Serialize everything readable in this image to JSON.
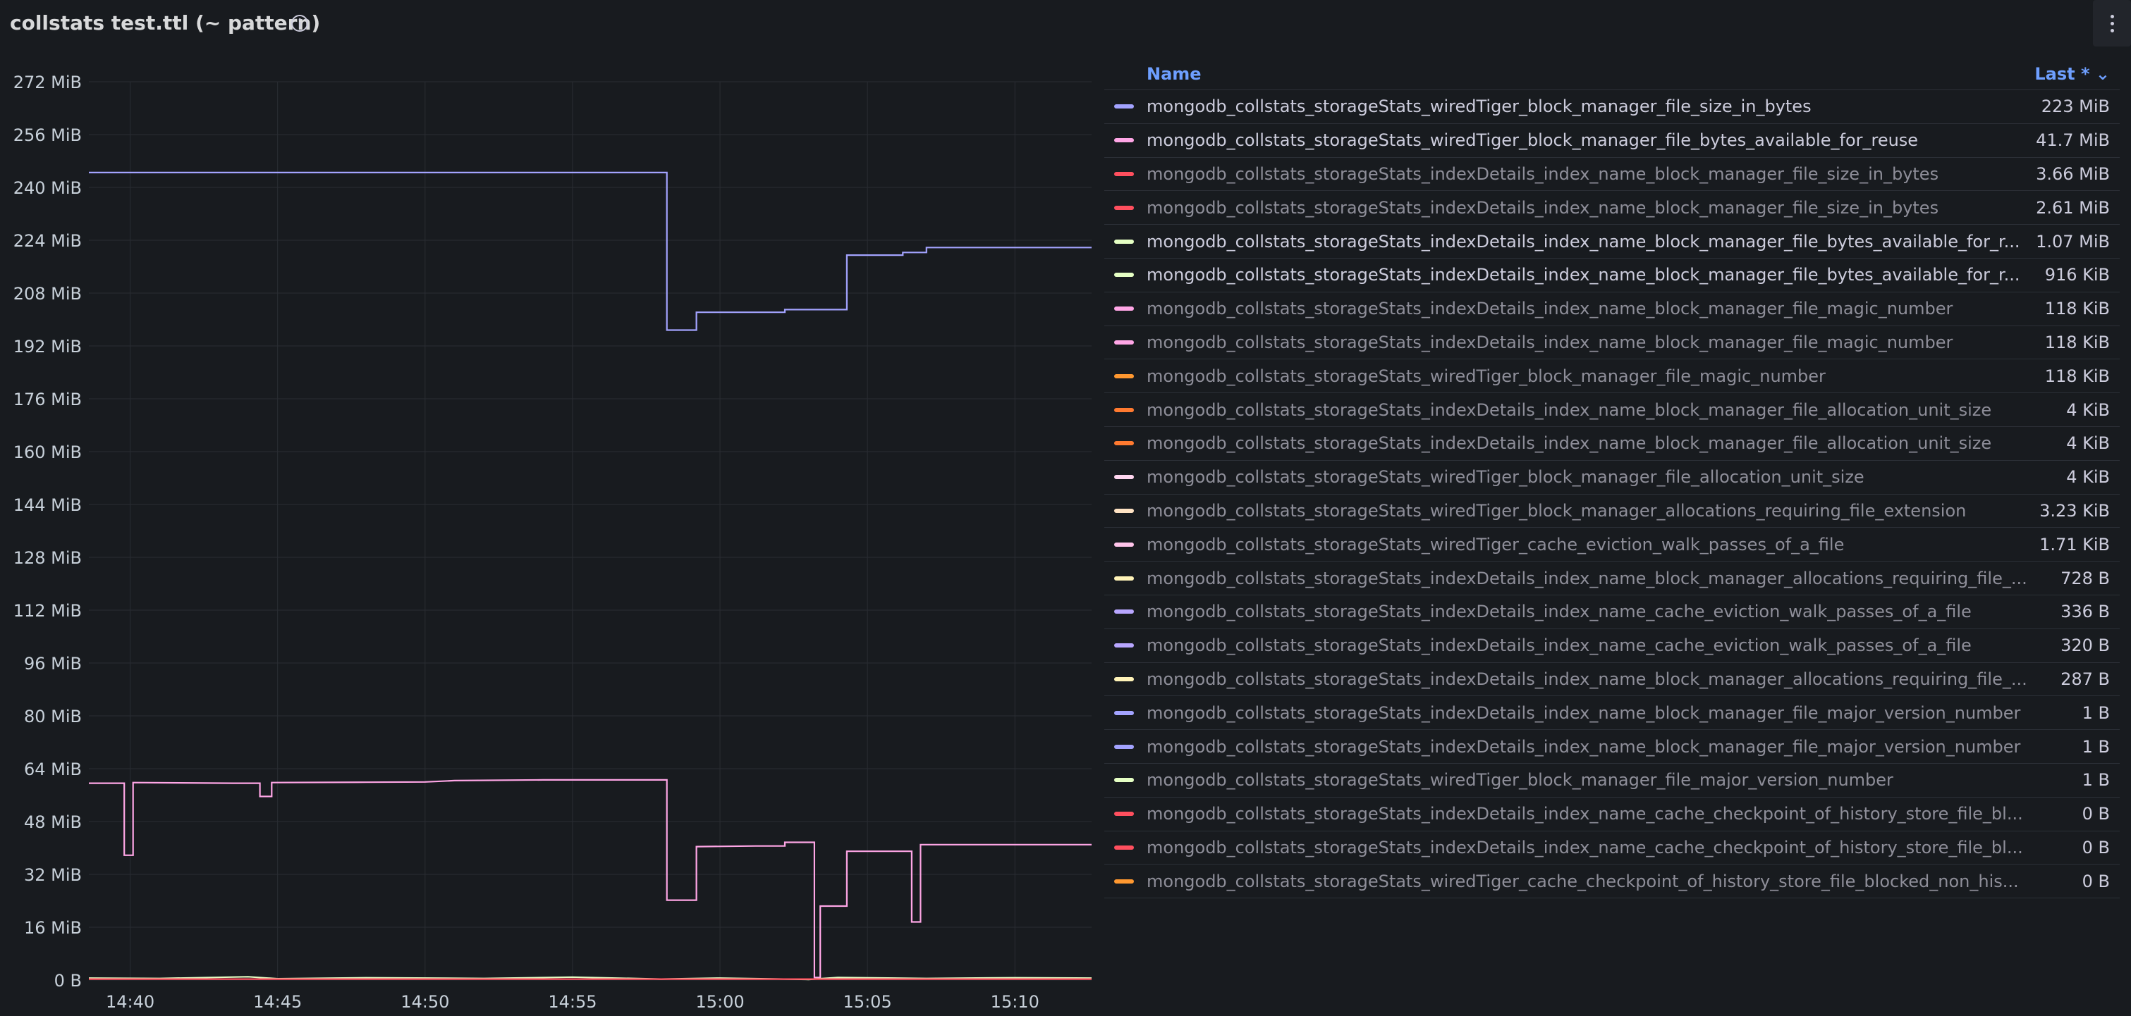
{
  "panel": {
    "title": "collstats test.ttl (~ pattern)",
    "info_icon": "info-circle-icon",
    "menu_icon": "vertical-ellipsis-icon"
  },
  "chart_data": {
    "type": "line",
    "y_ticks": [
      "272 MiB",
      "256 MiB",
      "240 MiB",
      "224 MiB",
      "208 MiB",
      "192 MiB",
      "176 MiB",
      "160 MiB",
      "144 MiB",
      "128 MiB",
      "112 MiB",
      "96 MiB",
      "80 MiB",
      "64 MiB",
      "48 MiB",
      "32 MiB",
      "16 MiB",
      "0 B"
    ],
    "y_tick_values": [
      272,
      256,
      240,
      224,
      208,
      192,
      176,
      160,
      144,
      128,
      112,
      96,
      80,
      64,
      48,
      32,
      16,
      0
    ],
    "ylim": [
      0,
      272
    ],
    "x_ticks": [
      "14:40",
      "14:45",
      "14:50",
      "14:55",
      "15:00",
      "15:05",
      "15:10"
    ],
    "x_tick_values": [
      40,
      45,
      50,
      55,
      60,
      65,
      70
    ],
    "xlim": [
      38.6,
      72.6
    ],
    "grid": true,
    "series": [
      {
        "name": "mongodb_collstats_storageStats_wiredTiger_block_manager_file_size_in_bytes",
        "color": "#a3a3ff",
        "points": [
          [
            38.6,
            244.5
          ],
          [
            58.2,
            244.5
          ],
          [
            58.2,
            196.8
          ],
          [
            59.2,
            196.8
          ],
          [
            59.2,
            202.2
          ],
          [
            62.2,
            202.2
          ],
          [
            62.2,
            203.0
          ],
          [
            64.3,
            203.0
          ],
          [
            64.3,
            219.5
          ],
          [
            66.2,
            219.5
          ],
          [
            66.2,
            220.3
          ],
          [
            67.0,
            220.3
          ],
          [
            67.0,
            221.8
          ],
          [
            72.6,
            221.8
          ]
        ]
      },
      {
        "name": "mongodb_collstats_storageStats_wiredTiger_block_manager_file_bytes_available_for_reuse",
        "color": "#ffa6e6",
        "points": [
          [
            38.6,
            59.6
          ],
          [
            39.8,
            59.6
          ],
          [
            39.8,
            37.8
          ],
          [
            40.1,
            37.8
          ],
          [
            40.1,
            59.8
          ],
          [
            43.5,
            59.6
          ],
          [
            44.4,
            59.6
          ],
          [
            44.4,
            55.6
          ],
          [
            44.8,
            55.6
          ],
          [
            44.8,
            59.8
          ],
          [
            48.0,
            59.9
          ],
          [
            50.0,
            60.0
          ],
          [
            51.0,
            60.4
          ],
          [
            54.0,
            60.6
          ],
          [
            55.5,
            60.6
          ],
          [
            58.2,
            60.6
          ],
          [
            58.2,
            24.2
          ],
          [
            59.2,
            24.2
          ],
          [
            59.2,
            40.4
          ],
          [
            61.2,
            40.6
          ],
          [
            62.2,
            40.6
          ],
          [
            62.2,
            41.7
          ],
          [
            63.2,
            41.7
          ],
          [
            63.2,
            0.8
          ],
          [
            63.4,
            0.8
          ],
          [
            63.4,
            22.4
          ],
          [
            64.3,
            22.4
          ],
          [
            64.3,
            39.0
          ],
          [
            66.0,
            39.0
          ],
          [
            66.5,
            39.0
          ],
          [
            66.5,
            17.6
          ],
          [
            66.8,
            17.6
          ],
          [
            66.8,
            41.0
          ],
          [
            72.6,
            41.0
          ]
        ]
      },
      {
        "name": "mongodb_collstats_storageStats_indexDetails_index_name_block_manager_file_bytes_available_for_r...",
        "color": "#e5ffc4",
        "points": [
          [
            38.6,
            0.6
          ],
          [
            41.0,
            0.5
          ],
          [
            44.0,
            1.0
          ],
          [
            45.0,
            0.4
          ],
          [
            48.0,
            0.7
          ],
          [
            52.0,
            0.5
          ],
          [
            55.0,
            0.9
          ],
          [
            58.0,
            0.3
          ],
          [
            60.0,
            0.6
          ],
          [
            63.0,
            0.2
          ],
          [
            64.0,
            0.8
          ],
          [
            67.0,
            0.5
          ],
          [
            70.0,
            0.7
          ],
          [
            72.6,
            0.6
          ]
        ]
      },
      {
        "name": "mongodb_collstats_storageStats_indexDetails_index_name_block_manager_file_size_in_bytes",
        "color": "#ff4f5e",
        "points": [
          [
            38.6,
            0.3
          ],
          [
            72.6,
            0.3
          ]
        ]
      }
    ]
  },
  "legend": {
    "header_name": "Name",
    "header_last": "Last * ⌄",
    "rows": [
      {
        "name": "mongodb_collstats_storageStats_wiredTiger_block_manager_file_size_in_bytes",
        "value": "223 MiB",
        "color": "#a3a3ff",
        "dim": false
      },
      {
        "name": "mongodb_collstats_storageStats_wiredTiger_block_manager_file_bytes_available_for_reuse",
        "value": "41.7 MiB",
        "color": "#ffa6e6",
        "dim": false
      },
      {
        "name": "mongodb_collstats_storageStats_indexDetails_index_name_block_manager_file_size_in_bytes",
        "value": "3.66 MiB",
        "color": "#ff4f5e",
        "dim": true
      },
      {
        "name": "mongodb_collstats_storageStats_indexDetails_index_name_block_manager_file_size_in_bytes",
        "value": "2.61 MiB",
        "color": "#ff4f5e",
        "dim": true
      },
      {
        "name": "mongodb_collstats_storageStats_indexDetails_index_name_block_manager_file_bytes_available_for_r...",
        "value": "1.07 MiB",
        "color": "#e5ffc4",
        "dim": false
      },
      {
        "name": "mongodb_collstats_storageStats_indexDetails_index_name_block_manager_file_bytes_available_for_r...",
        "value": "916 KiB",
        "color": "#e5ffc4",
        "dim": false
      },
      {
        "name": "mongodb_collstats_storageStats_indexDetails_index_name_block_manager_file_magic_number",
        "value": "118 KiB",
        "color": "#ffa6e6",
        "dim": true
      },
      {
        "name": "mongodb_collstats_storageStats_indexDetails_index_name_block_manager_file_magic_number",
        "value": "118 KiB",
        "color": "#ffa6e6",
        "dim": true
      },
      {
        "name": "mongodb_collstats_storageStats_wiredTiger_block_manager_file_magic_number",
        "value": "118 KiB",
        "color": "#ff9830",
        "dim": true
      },
      {
        "name": "mongodb_collstats_storageStats_indexDetails_index_name_block_manager_file_allocation_unit_size",
        "value": "4 KiB",
        "color": "#ff7a30",
        "dim": true
      },
      {
        "name": "mongodb_collstats_storageStats_indexDetails_index_name_block_manager_file_allocation_unit_size",
        "value": "4 KiB",
        "color": "#ff7a30",
        "dim": true
      },
      {
        "name": "mongodb_collstats_storageStats_wiredTiger_block_manager_file_allocation_unit_size",
        "value": "4 KiB",
        "color": "#ffd6f0",
        "dim": true
      },
      {
        "name": "mongodb_collstats_storageStats_wiredTiger_block_manager_allocations_requiring_file_extension",
        "value": "3.23 KiB",
        "color": "#ffe3c4",
        "dim": true
      },
      {
        "name": "mongodb_collstats_storageStats_wiredTiger_cache_eviction_walk_passes_of_a_file",
        "value": "1.71 KiB",
        "color": "#ffc4ea",
        "dim": true
      },
      {
        "name": "mongodb_collstats_storageStats_indexDetails_index_name_block_manager_allocations_requiring_file_...",
        "value": "728 B",
        "color": "#fff3b8",
        "dim": true
      },
      {
        "name": "mongodb_collstats_storageStats_indexDetails_index_name_cache_eviction_walk_passes_of_a_file",
        "value": "336 B",
        "color": "#b8a6ff",
        "dim": true
      },
      {
        "name": "mongodb_collstats_storageStats_indexDetails_index_name_cache_eviction_walk_passes_of_a_file",
        "value": "320 B",
        "color": "#b8a6ff",
        "dim": true
      },
      {
        "name": "mongodb_collstats_storageStats_indexDetails_index_name_block_manager_allocations_requiring_file_...",
        "value": "287 B",
        "color": "#fff3b8",
        "dim": true
      },
      {
        "name": "mongodb_collstats_storageStats_indexDetails_index_name_block_manager_file_major_version_number",
        "value": "1 B",
        "color": "#a3a3ff",
        "dim": true
      },
      {
        "name": "mongodb_collstats_storageStats_indexDetails_index_name_block_manager_file_major_version_number",
        "value": "1 B",
        "color": "#a3a3ff",
        "dim": true
      },
      {
        "name": "mongodb_collstats_storageStats_wiredTiger_block_manager_file_major_version_number",
        "value": "1 B",
        "color": "#e5ffc4",
        "dim": true
      },
      {
        "name": "mongodb_collstats_storageStats_indexDetails_index_name_cache_checkpoint_of_history_store_file_bl...",
        "value": "0 B",
        "color": "#ff4f5e",
        "dim": true
      },
      {
        "name": "mongodb_collstats_storageStats_indexDetails_index_name_cache_checkpoint_of_history_store_file_bl...",
        "value": "0 B",
        "color": "#ff4f5e",
        "dim": true
      },
      {
        "name": "mongodb_collstats_storageStats_wiredTiger_cache_checkpoint_of_history_store_file_blocked_non_his...",
        "value": "0 B",
        "color": "#ff9830",
        "dim": true
      }
    ]
  }
}
